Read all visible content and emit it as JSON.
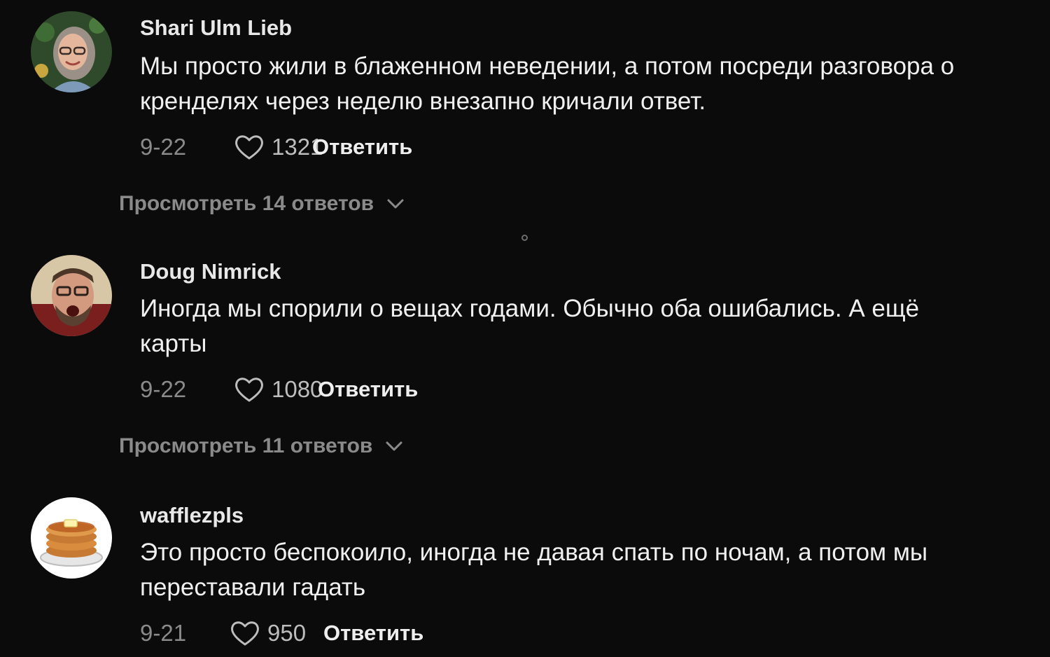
{
  "comments": [
    {
      "username": "Shari Ulm Lieb",
      "text": "Мы просто жили в блаженном неведении, а потом посреди разговора о кренделях через неделю внезапно кричали ответ.",
      "date": "9-22",
      "likes": "1321",
      "reply_label": "Ответить",
      "view_replies": "Просмотреть 14 ответов",
      "avatar_icon": "user-photo-woman-glasses"
    },
    {
      "username": "Doug Nimrick",
      "text": "Иногда мы спорили о вещах годами. Обычно оба ошибались. А ещё карты",
      "date": "9-22",
      "likes": "1080",
      "reply_label": "Ответить",
      "view_replies": "Просмотреть 11 ответов",
      "avatar_icon": "user-photo-man-glasses"
    },
    {
      "username": "wafflezpls",
      "text": "Это просто беспокоило, иногда не давая спать по ночам, а потом мы переставали гадать",
      "date": "9-21",
      "likes": "950",
      "reply_label": "Ответить",
      "avatar_icon": "pancakes-icon"
    }
  ],
  "colors": {
    "background": "#0b0b0c",
    "text": "#f0f0f0",
    "muted": "#8a8a8a"
  }
}
